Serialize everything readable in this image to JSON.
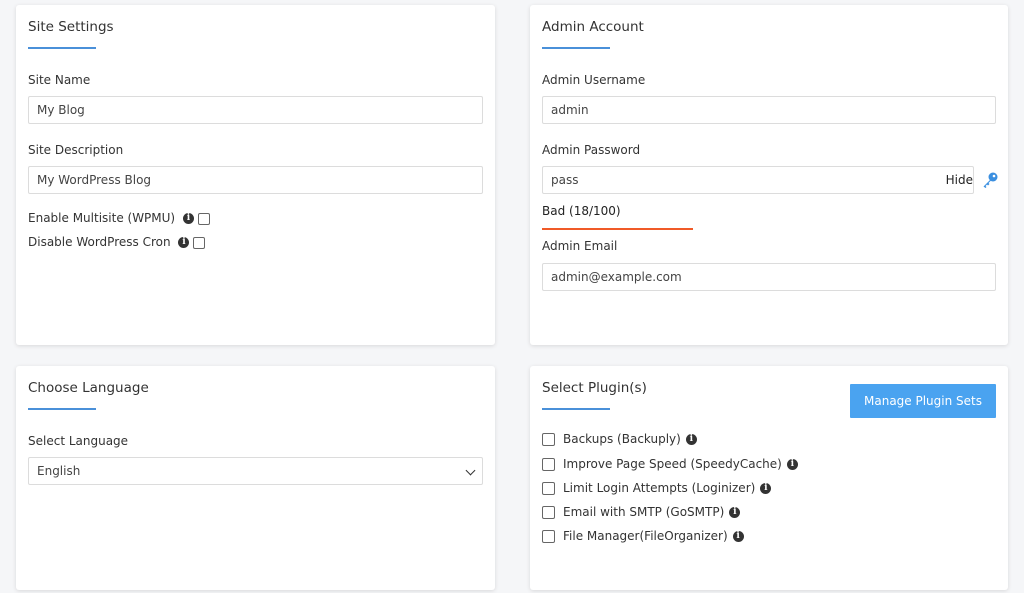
{
  "site_settings": {
    "title": "Site Settings",
    "site_name_label": "Site Name",
    "site_name_value": "My Blog",
    "site_desc_label": "Site Description",
    "site_desc_value": "My WordPress Blog",
    "multisite_label": "Enable Multisite (WPMU)",
    "cron_label": "Disable WordPress Cron"
  },
  "admin_account": {
    "title": "Admin Account",
    "username_label": "Admin Username",
    "username_value": "admin",
    "password_label": "Admin Password",
    "password_value": "pass",
    "hide_label": "Hide",
    "strength_text": "Bad (18/100)",
    "strength_color": "#f05a28",
    "email_label": "Admin Email",
    "email_value": "admin@example.com"
  },
  "language": {
    "title": "Choose Language",
    "select_label": "Select Language",
    "selected": "English"
  },
  "plugins": {
    "title": "Select Plugin(s)",
    "manage_button": "Manage Plugin Sets",
    "items": [
      {
        "label": "Backups (Backuply)"
      },
      {
        "label": "Improve Page Speed (SpeedyCache)"
      },
      {
        "label": "Limit Login Attempts (Loginizer)"
      },
      {
        "label": "Email with SMTP (GoSMTP)"
      },
      {
        "label": "File Manager(FileOrganizer)"
      }
    ]
  },
  "colors": {
    "accent": "#4a90d9",
    "button": "#4aa3f0",
    "key_icon": "#3b8fe0"
  }
}
